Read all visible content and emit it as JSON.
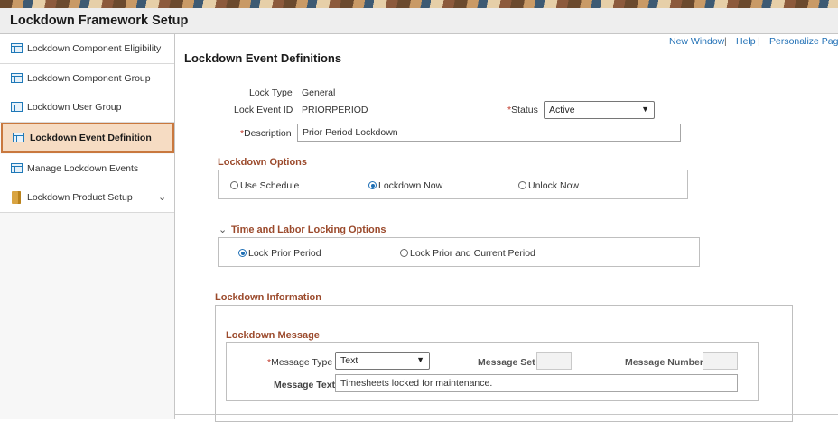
{
  "app": {
    "title": "Lockdown Framework Setup"
  },
  "sidebar": {
    "items": [
      {
        "label": "Lockdown Component Eligibility",
        "icon": "component-icon"
      },
      {
        "label": "Lockdown Component Group",
        "icon": "component-icon"
      },
      {
        "label": "Lockdown User Group",
        "icon": "component-icon"
      },
      {
        "label": "Lockdown Event Definition",
        "icon": "component-icon",
        "active": true
      },
      {
        "label": "Manage Lockdown Events",
        "icon": "component-icon"
      },
      {
        "label": "Lockdown Product Setup",
        "icon": "folder-icon",
        "expandable": true
      }
    ]
  },
  "header": {
    "links": [
      "New Window",
      "Help",
      "Personalize Page"
    ],
    "separator": "|"
  },
  "page": {
    "title": "Lockdown Event Definitions",
    "lock_type_label": "Lock Type",
    "lock_type_value": "General",
    "lock_event_id_label": "Lock Event ID",
    "lock_event_id_value": "PRIORPERIOD",
    "status_label": "Status",
    "status_value": "Active",
    "description_label": "Description",
    "description_value": "Prior Period Lockdown",
    "required_marker": "*"
  },
  "lockdown_options": {
    "title": "Lockdown Options",
    "options": [
      "Use Schedule",
      "Lockdown Now",
      "Unlock Now"
    ],
    "selected": "Lockdown Now"
  },
  "time_labor": {
    "title": "Time and Labor Locking Options",
    "options": [
      "Lock Prior Period",
      "Lock Prior and Current Period"
    ],
    "selected": "Lock Prior Period"
  },
  "lockdown_info": {
    "title": "Lockdown Information",
    "message_section_title": "Lockdown Message",
    "message_type_label": "Message Type",
    "message_type_value": "Text",
    "message_set_label": "Message Set",
    "message_set_value": "",
    "message_number_label": "Message Number",
    "message_number_value": "",
    "message_text_label": "Message Text",
    "message_text_value": "Timesheets locked for maintenance."
  },
  "colors": {
    "link": "#1f6fb5",
    "section_title": "#9b4a2c",
    "active_nav_bg": "#f6dcc3",
    "active_nav_border": "#c9783e",
    "required": "#c0392b"
  }
}
